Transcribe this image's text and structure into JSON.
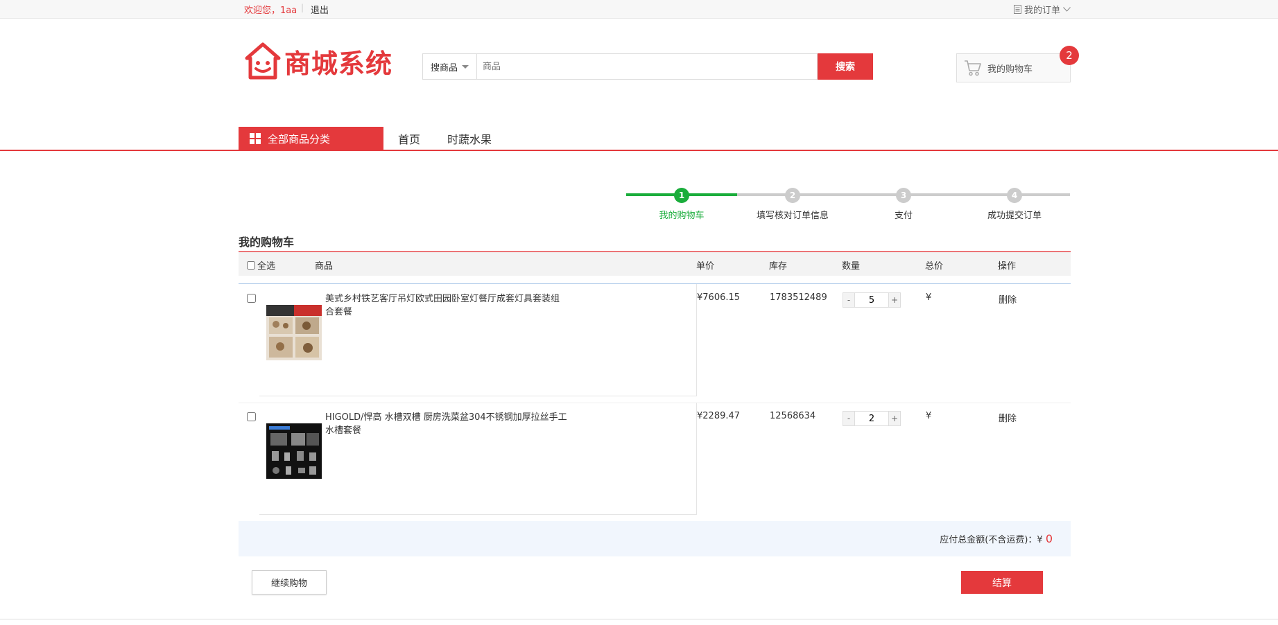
{
  "topbar": {
    "welcome": "欢迎您，1aa",
    "separator": "|",
    "logout": "退出",
    "my_orders": "我的订单"
  },
  "header": {
    "logo_text": "商城系统",
    "search_type": "搜商品",
    "search_placeholder": "商品",
    "search_button": "搜索",
    "cart_label": "我的购物车",
    "cart_count": "2"
  },
  "nav": {
    "all_categories": "全部商品分类",
    "links": [
      "首页",
      "时蔬水果"
    ]
  },
  "steps": [
    {
      "num": "1",
      "label": "我的购物车",
      "active": true
    },
    {
      "num": "2",
      "label": "填写核对订单信息",
      "active": false
    },
    {
      "num": "3",
      "label": "支付",
      "active": false
    },
    {
      "num": "4",
      "label": "成功提交订单",
      "active": false
    }
  ],
  "cart": {
    "title": "我的购物车",
    "columns": {
      "select_all": "全选",
      "goods": "商品",
      "price": "单价",
      "stock": "库存",
      "quantity": "数量",
      "total": "总价",
      "action": "操作"
    },
    "items": [
      {
        "name": "美式乡村铁艺客厅吊灯欧式田园卧室灯餐厅成套灯具套装组合套餐",
        "price": "¥7606.15",
        "stock": "1783512489",
        "quantity": "5",
        "total": "¥",
        "delete": "删除",
        "minus": "-",
        "plus": "+"
      },
      {
        "name": "HIGOLD/悍高 水槽双槽 厨房洗菜盆304不锈钢加厚拉丝手工水槽套餐",
        "price": "¥2289.47",
        "stock": "12568634",
        "quantity": "2",
        "total": "¥",
        "delete": "删除",
        "minus": "-",
        "plus": "+"
      }
    ],
    "summary_label": "应付总金额(不含运费)：¥ ",
    "summary_value": "0",
    "continue_button": "继续购物",
    "checkout_button": "结算"
  },
  "colors": {
    "brand": "#e4393c",
    "step_active": "#1aad3b",
    "step_inactive": "#cccccc"
  }
}
